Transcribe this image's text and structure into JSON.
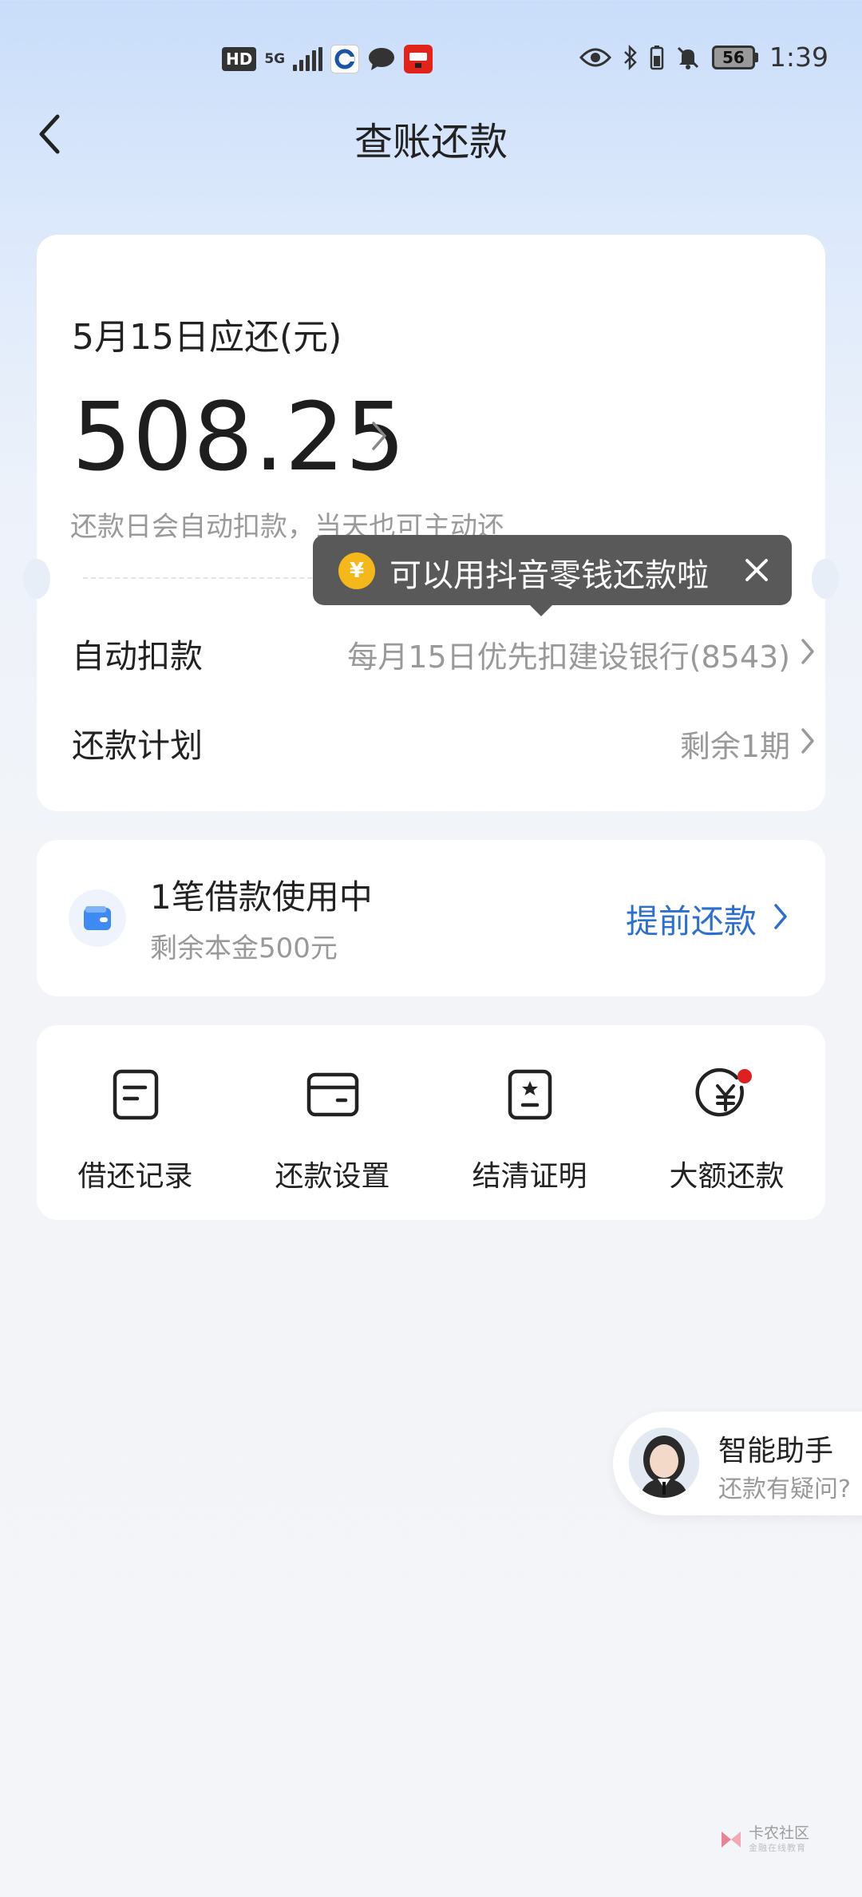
{
  "status_bar": {
    "hd": "HD",
    "network": "5G",
    "battery": "56",
    "time": "1:39"
  },
  "header": {
    "title": "查账还款"
  },
  "bill": {
    "due_label": "5月15日应还(元)",
    "amount": "508.25",
    "auto_note": "还款日会自动扣款，当天也可主动还"
  },
  "tooltip": {
    "coin_symbol": "¥",
    "text": "可以用抖音零钱还款啦"
  },
  "rows": {
    "auto_debit_label": "自动扣款",
    "auto_debit_value": "每月15日优先扣建设银行(8543)",
    "plan_label": "还款计划",
    "plan_value": "剩余1期"
  },
  "loan": {
    "title": "1笔借款使用中",
    "subtitle": "剩余本金500元",
    "prepay_label": "提前还款"
  },
  "quick_actions": [
    {
      "label": "借还记录",
      "icon": "document-icon"
    },
    {
      "label": "还款设置",
      "icon": "card-icon"
    },
    {
      "label": "结清证明",
      "icon": "certificate-icon"
    },
    {
      "label": "大额还款",
      "icon": "yuan-circle-icon"
    }
  ],
  "assistant": {
    "title": "智能助手",
    "subtitle": "还款有疑问?"
  },
  "watermark": {
    "text": "卡农社区",
    "sub": "金融在线教育"
  },
  "colors": {
    "accent_blue": "#2b6fd1",
    "tooltip_bg": "#595959",
    "coin": "#f5b81a",
    "badge_red": "#e02020"
  }
}
